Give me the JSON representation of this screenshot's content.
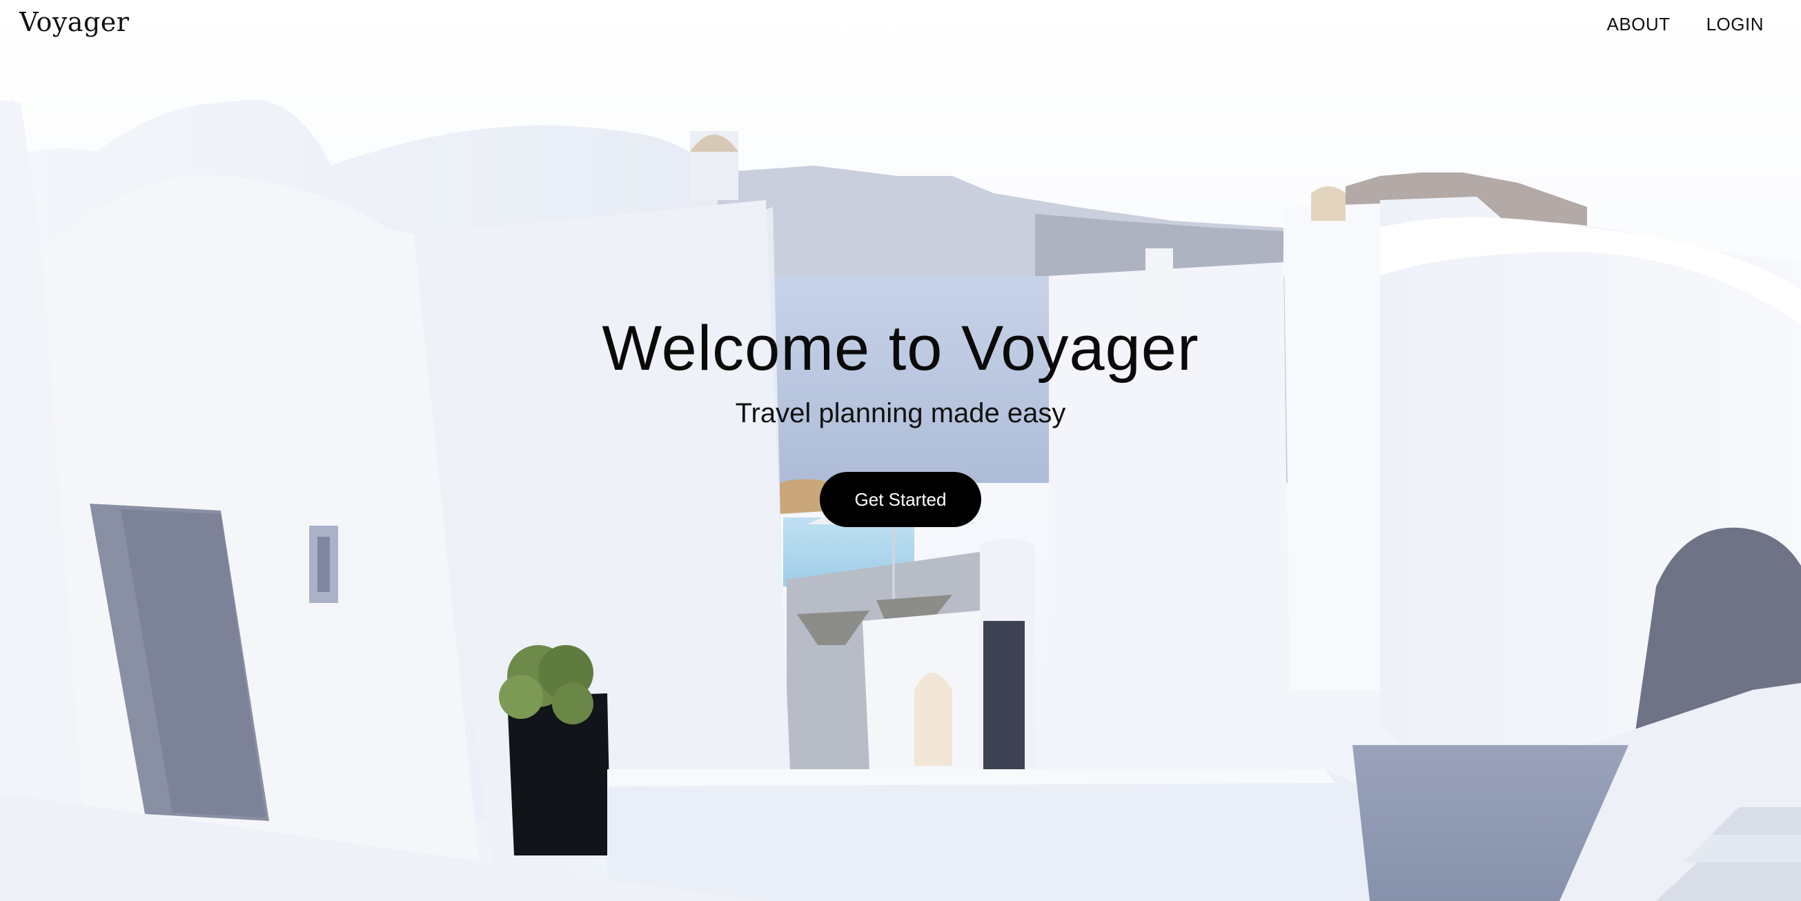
{
  "brand": {
    "logo_text": "Voyager"
  },
  "nav": {
    "items": [
      {
        "label": "ABOUT"
      },
      {
        "label": "LOGIN"
      }
    ]
  },
  "hero": {
    "title": "Welcome to Voyager",
    "subtitle": "Travel planning made easy",
    "cta_label": "Get Started",
    "background": "photo of white Santorini-style buildings with sea and mountains"
  },
  "colors": {
    "text": "#0a0a0a",
    "button_bg": "#000000",
    "button_text": "#ffffff",
    "sky": "#f6f8fc",
    "sea": "#b8c6de"
  }
}
